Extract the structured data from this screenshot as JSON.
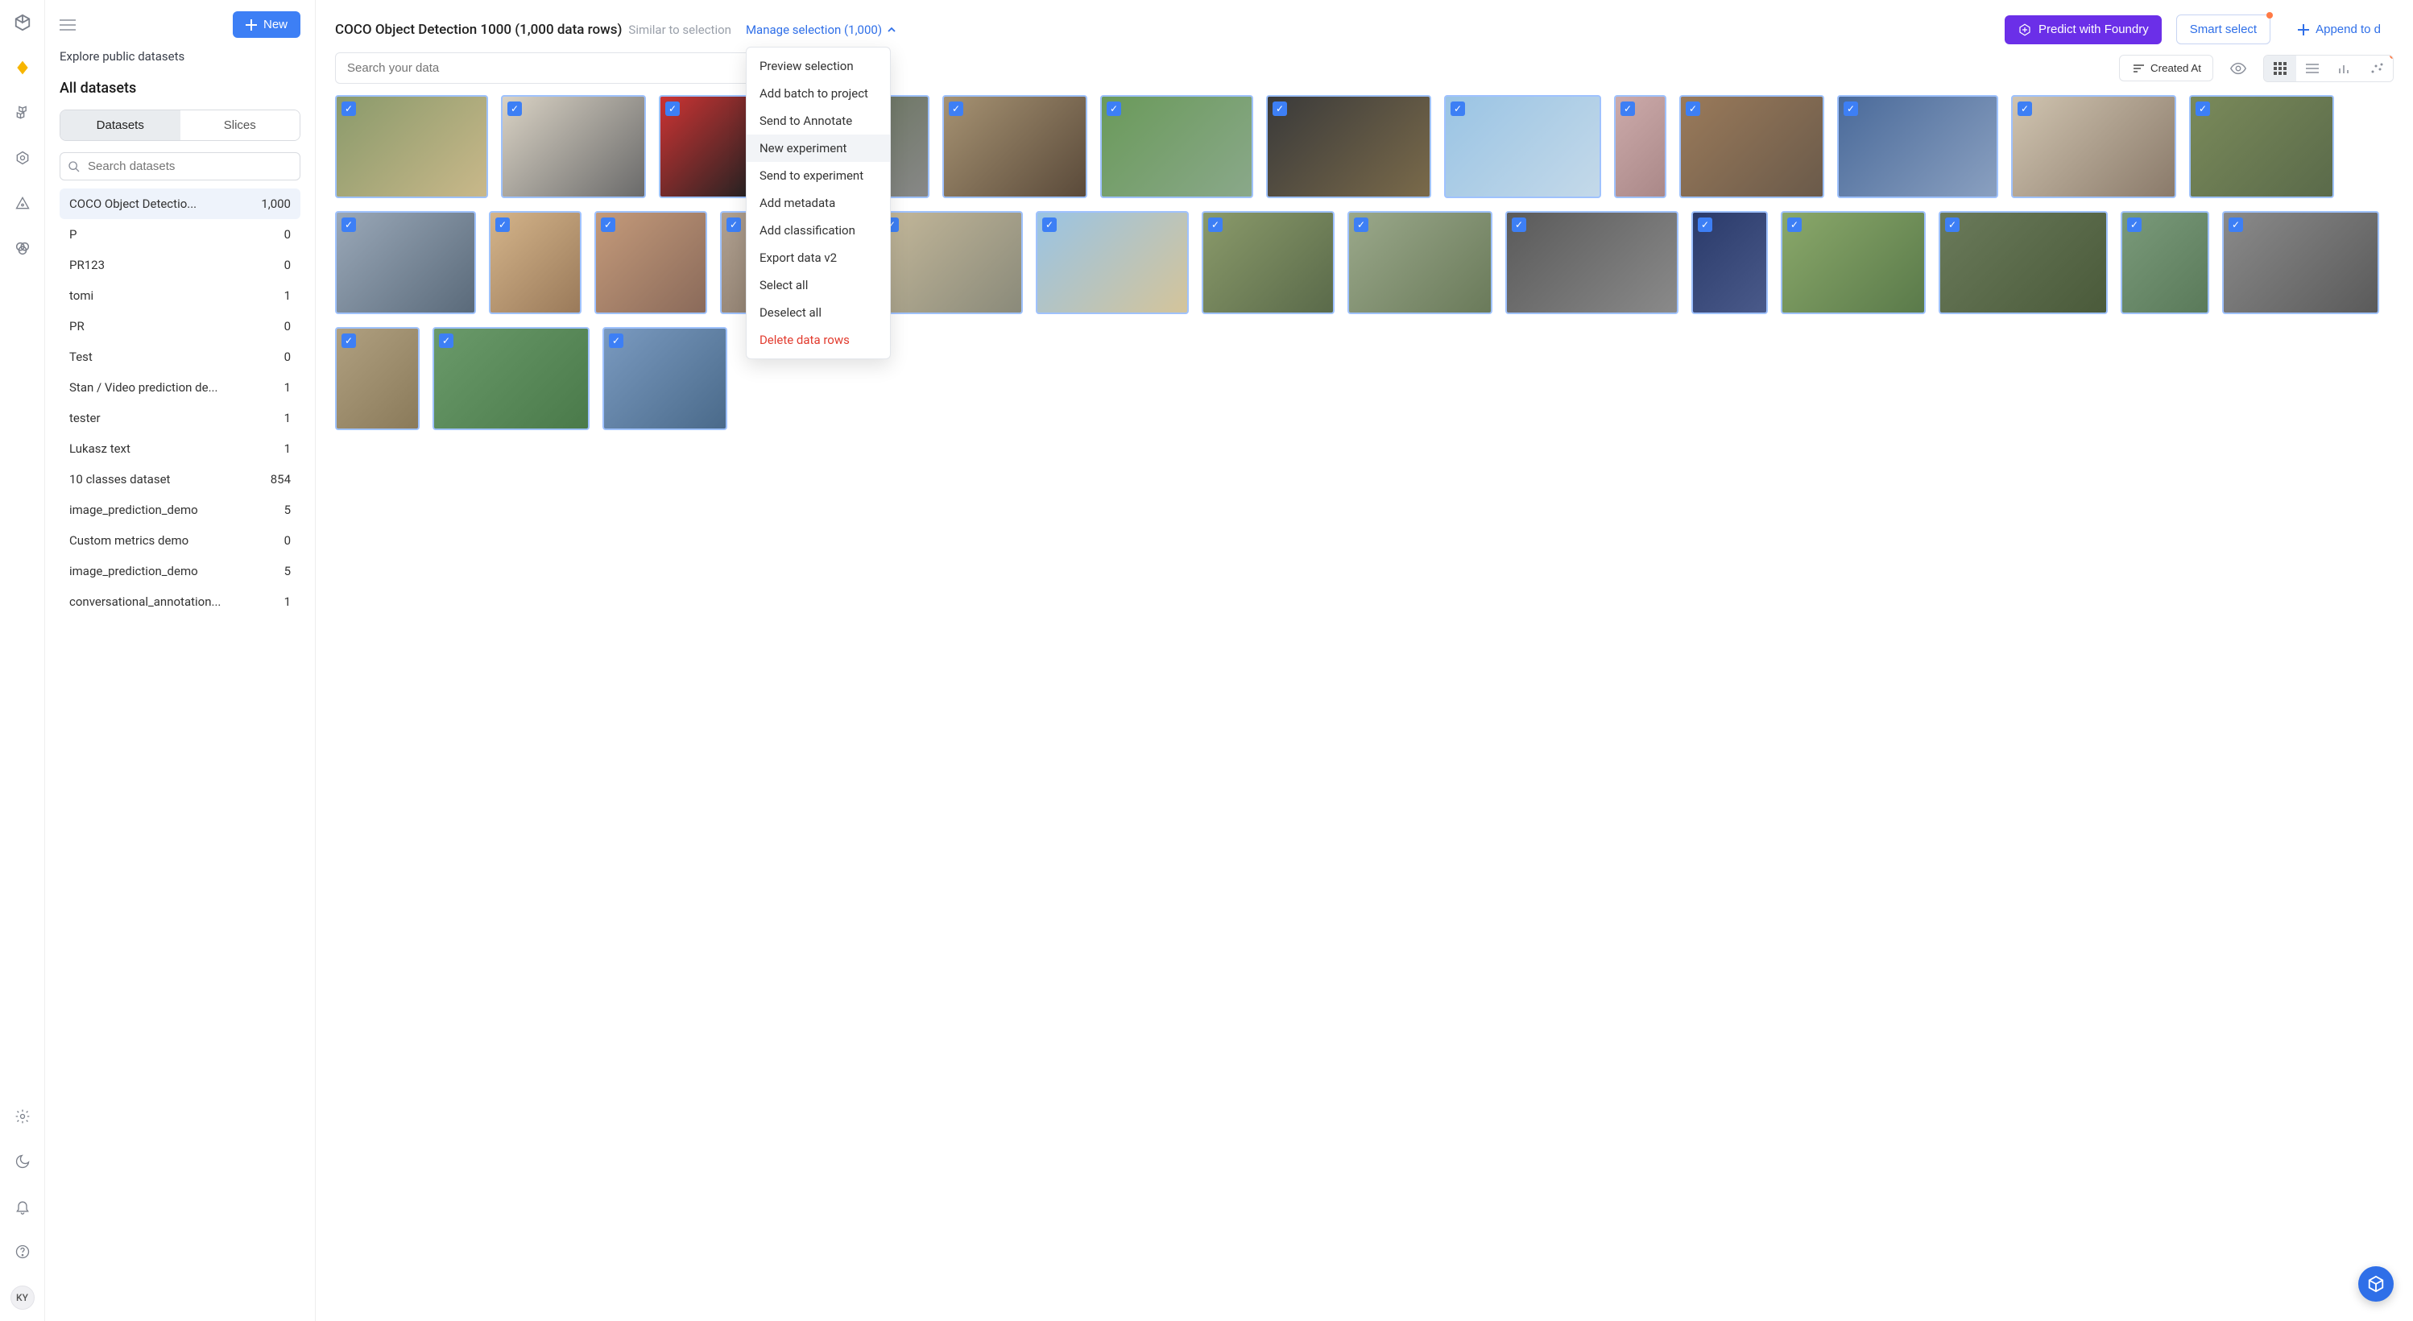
{
  "rail": {
    "avatar_initials": "KY"
  },
  "sidebar": {
    "new_button": "New",
    "explore_link": "Explore public datasets",
    "heading": "All datasets",
    "tabs": {
      "datasets": "Datasets",
      "slices": "Slices"
    },
    "search_placeholder": "Search datasets",
    "items": [
      {
        "name": "COCO Object Detectio...",
        "count": "1,000",
        "selected": true
      },
      {
        "name": "P",
        "count": "0"
      },
      {
        "name": "PR123",
        "count": "0"
      },
      {
        "name": "tomi",
        "count": "1"
      },
      {
        "name": "PR",
        "count": "0"
      },
      {
        "name": "Test",
        "count": "0"
      },
      {
        "name": "Stan / Video prediction de...",
        "count": "1"
      },
      {
        "name": "tester",
        "count": "1"
      },
      {
        "name": "Lukasz text",
        "count": "1"
      },
      {
        "name": "10 classes dataset",
        "count": "854"
      },
      {
        "name": "image_prediction_demo",
        "count": "5"
      },
      {
        "name": "Custom metrics demo",
        "count": "0"
      },
      {
        "name": "image_prediction_demo",
        "count": "5"
      },
      {
        "name": "conversational_annotation...",
        "count": "1"
      }
    ]
  },
  "topbar": {
    "title": "COCO Object Detection 1000 (1,000 data rows)",
    "similar_hint": "Similar to selection",
    "manage_label": "Manage selection (1,000)",
    "predict_button": "Predict with Foundry",
    "smart_select_button": "Smart select",
    "append_button": "Append to d"
  },
  "manage_menu": [
    {
      "label": "Preview selection"
    },
    {
      "label": "Add batch to project"
    },
    {
      "label": "Send to Annotate"
    },
    {
      "label": "New experiment",
      "hover": true
    },
    {
      "label": "Send to experiment"
    },
    {
      "label": "Add metadata"
    },
    {
      "label": "Add classification"
    },
    {
      "label": "Export data v2"
    },
    {
      "label": "Select all"
    },
    {
      "label": "Deselect all"
    },
    {
      "label": "Delete data rows",
      "danger": true
    }
  ],
  "subbar": {
    "search_placeholder": "Search your data",
    "sort_label": "Created At"
  },
  "grid": {
    "rows": [
      [
        190,
        180,
        120,
        200,
        180,
        190
      ],
      [
        205,
        195,
        65,
        180,
        200,
        205
      ],
      [
        180,
        175,
        115,
        140,
        180,
        180
      ],
      [
        190,
        165,
        180,
        215,
        95,
        180
      ],
      [
        210,
        110,
        195,
        105,
        195,
        155
      ]
    ]
  }
}
